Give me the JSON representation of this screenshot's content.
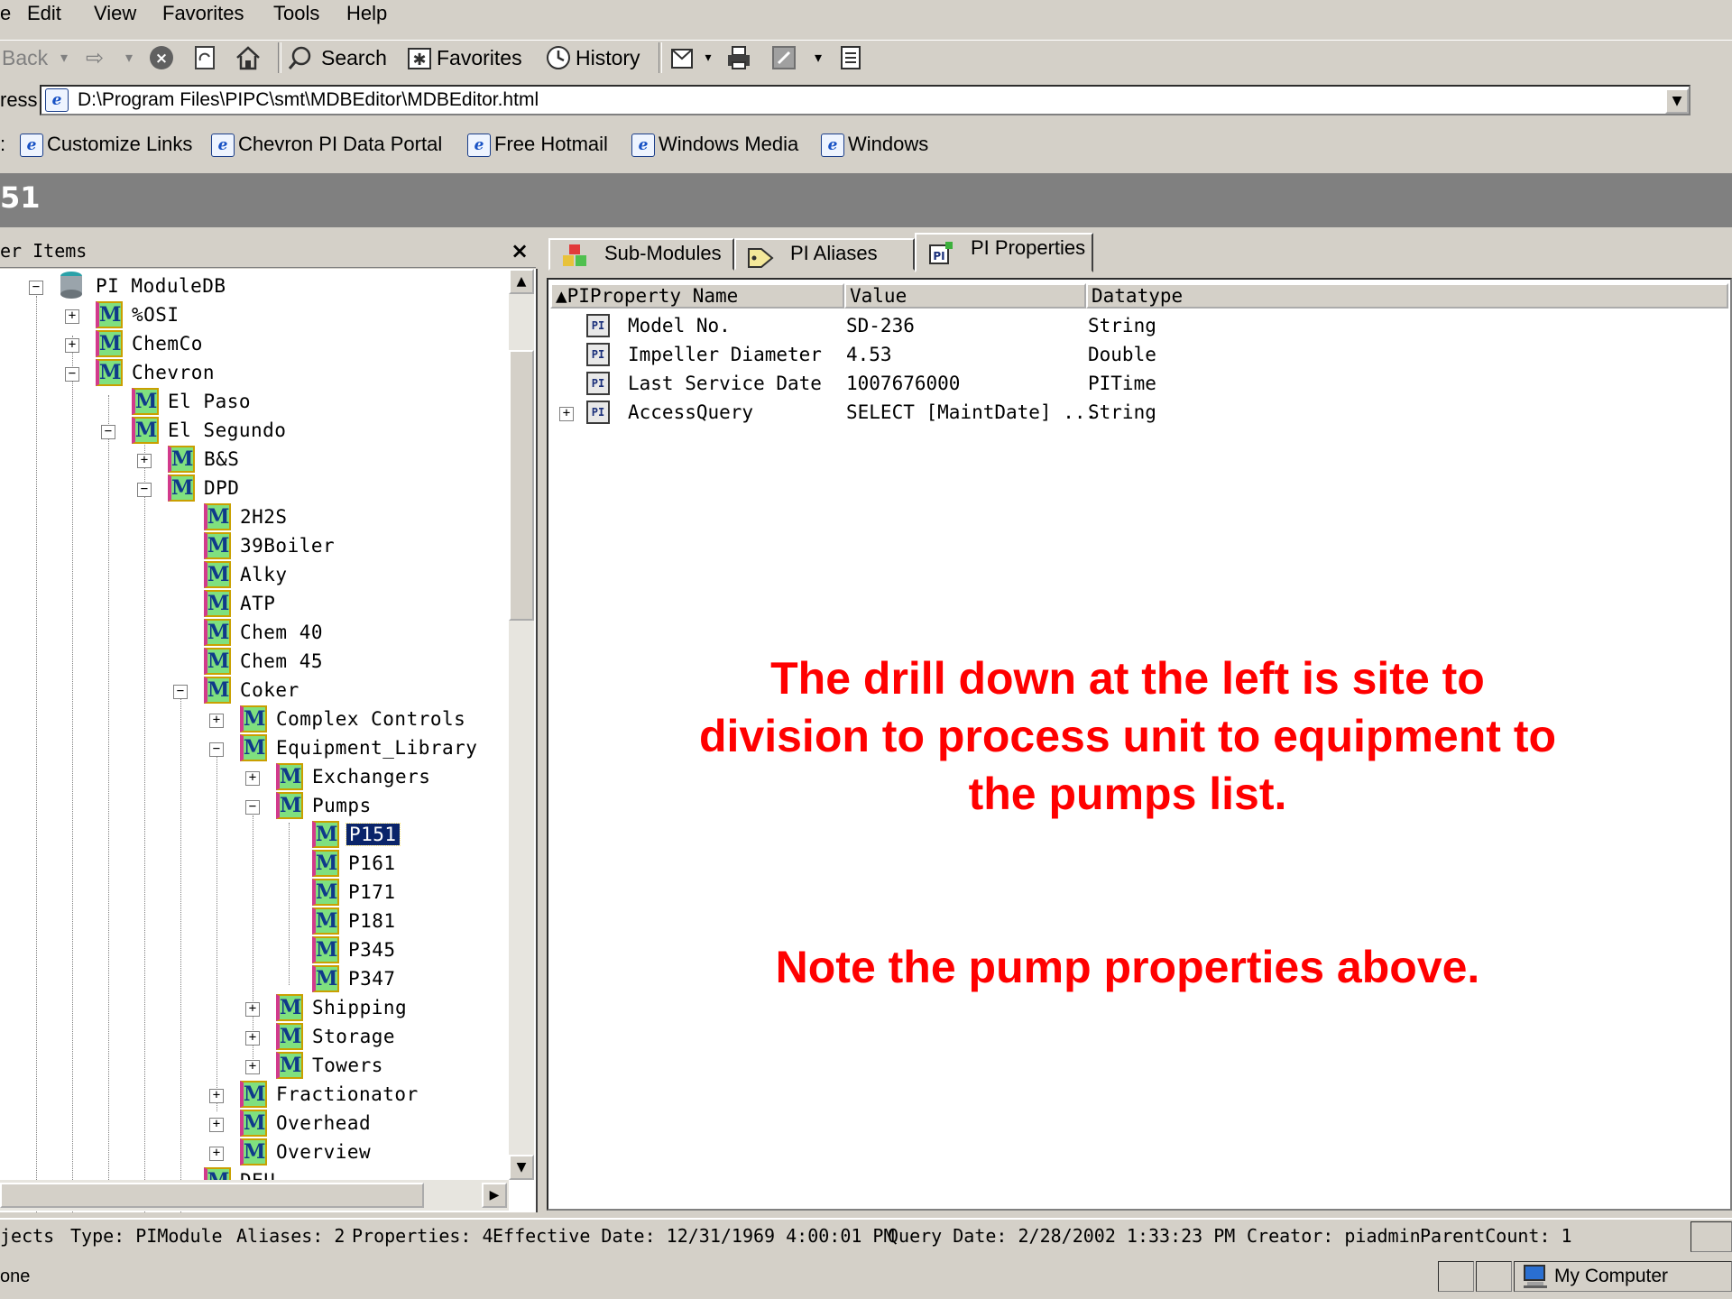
{
  "menu": [
    "e",
    "Edit",
    "View",
    "Favorites",
    "Tools",
    "Help"
  ],
  "toolbar": {
    "back": "Back",
    "search": "Search",
    "favorites": "Favorites",
    "history": "History"
  },
  "address": {
    "label": "ress",
    "value": "D:\\Program Files\\PIPC\\smt\\MDBEditor\\MDBEditor.html"
  },
  "links": {
    "label": ":",
    "items": [
      "Customize Links",
      "Chevron PI Data Portal",
      "Free Hotmail",
      "Windows Media",
      "Windows"
    ]
  },
  "page_title": "51",
  "left_panel": {
    "header": "er Items",
    "close": "×"
  },
  "tree": [
    {
      "label": "PI ModuleDB"
    },
    {
      "label": "%OSI"
    },
    {
      "label": "ChemCo"
    },
    {
      "label": "Chevron"
    },
    {
      "label": "El Paso"
    },
    {
      "label": "El Segundo"
    },
    {
      "label": "B&S"
    },
    {
      "label": "DPD"
    },
    {
      "label": "2H2S"
    },
    {
      "label": "39Boiler"
    },
    {
      "label": "Alky"
    },
    {
      "label": "ATP"
    },
    {
      "label": "Chem 40"
    },
    {
      "label": "Chem 45"
    },
    {
      "label": "Coker"
    },
    {
      "label": "Complex Controls"
    },
    {
      "label": "Equipment_Library"
    },
    {
      "label": "Exchangers"
    },
    {
      "label": "Pumps"
    },
    {
      "label": "P151"
    },
    {
      "label": "P161"
    },
    {
      "label": "P171"
    },
    {
      "label": "P181"
    },
    {
      "label": "P345"
    },
    {
      "label": "P347"
    },
    {
      "label": "Shipping"
    },
    {
      "label": "Storage"
    },
    {
      "label": "Towers"
    },
    {
      "label": "Fractionator"
    },
    {
      "label": "Overhead"
    },
    {
      "label": "Overview"
    },
    {
      "label": "DEU"
    }
  ],
  "tabs": [
    {
      "label": "Sub-Modules"
    },
    {
      "label": "PI Aliases"
    },
    {
      "label": "PI Properties"
    }
  ],
  "properties": {
    "columns": [
      "▲PIProperty Name",
      "Value",
      "Datatype"
    ],
    "rows": [
      {
        "name": "Model No.",
        "value": "SD-236",
        "type": "String"
      },
      {
        "name": "Impeller Diameter",
        "value": "4.53",
        "type": "Double"
      },
      {
        "name": "Last Service Date",
        "value": "1007676000",
        "type": "PITime"
      },
      {
        "name": "AccessQuery",
        "value": "SELECT [MaintDate] ...",
        "type": "String"
      }
    ]
  },
  "annotation": {
    "line1": "The drill down at the left  is site to division to process unit to equipment to the pumps list.",
    "line2": "Note the pump properties above."
  },
  "status": {
    "objects": "jects",
    "type": "Type: PIModule",
    "aliases": "Aliases: 2",
    "properties": "Properties: 4",
    "effective": "Effective Date: 12/31/1969 4:00:01 PM",
    "query": "Query Date: 2/28/2002 1:33:23 PM",
    "creator": "Creator: piadmin",
    "parent": "ParentCount: 1"
  },
  "ie_status": {
    "done": "one",
    "zone": "My Computer"
  }
}
